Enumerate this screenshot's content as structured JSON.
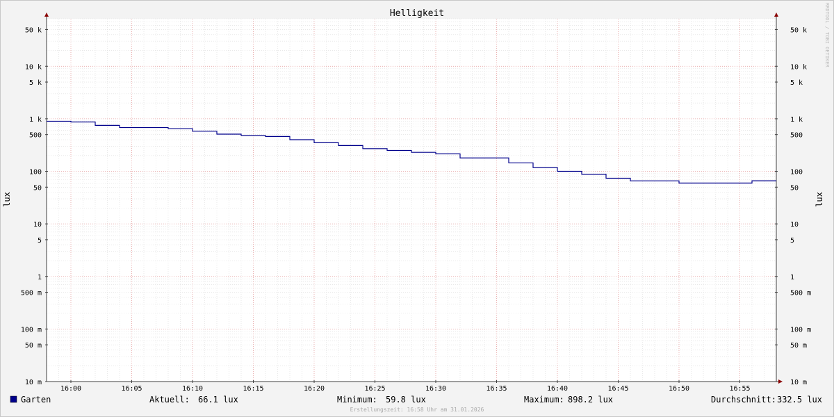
{
  "chart_data": {
    "type": "line",
    "title": "Helligkeit",
    "ylabel": "lux",
    "ylabel_right": "lux",
    "yscale": "log",
    "ylim": [
      0.01,
      80000
    ],
    "xlim": [
      "15:58",
      "16:58"
    ],
    "y_ticks": [
      {
        "value": 50000,
        "label": "50 k"
      },
      {
        "value": 10000,
        "label": "10 k"
      },
      {
        "value": 5000,
        "label": "5 k"
      },
      {
        "value": 1000,
        "label": "1 k"
      },
      {
        "value": 500,
        "label": "500"
      },
      {
        "value": 100,
        "label": "100"
      },
      {
        "value": 50,
        "label": "50"
      },
      {
        "value": 10,
        "label": "10"
      },
      {
        "value": 5,
        "label": "5"
      },
      {
        "value": 1,
        "label": "1"
      },
      {
        "value": 0.5,
        "label": "500 m"
      },
      {
        "value": 0.1,
        "label": "100 m"
      },
      {
        "value": 0.05,
        "label": "50 m"
      },
      {
        "value": 0.01,
        "label": "10 m"
      }
    ],
    "x_ticks": [
      "16:00",
      "16:05",
      "16:10",
      "16:15",
      "16:20",
      "16:25",
      "16:30",
      "16:35",
      "16:40",
      "16:45",
      "16:50",
      "16:55"
    ],
    "grid": true,
    "series": [
      {
        "name": "Garten",
        "color": "#00008b",
        "x": [
          "15:58",
          "16:00",
          "16:02",
          "16:04",
          "16:06",
          "16:08",
          "16:10",
          "16:12",
          "16:14",
          "16:16",
          "16:18",
          "16:20",
          "16:22",
          "16:24",
          "16:26",
          "16:28",
          "16:30",
          "16:32",
          "16:34",
          "16:36",
          "16:38",
          "16:40",
          "16:42",
          "16:44",
          "16:46",
          "16:48",
          "16:50",
          "16:52",
          "16:54",
          "16:56",
          "16:58"
        ],
        "values": [
          898.2,
          870,
          750,
          680,
          680,
          650,
          580,
          510,
          480,
          460,
          400,
          350,
          310,
          270,
          250,
          230,
          215,
          180,
          180,
          145,
          118,
          100,
          88,
          74,
          66,
          66,
          59.8,
          59.8,
          59.8,
          66.1,
          66.1
        ]
      }
    ],
    "stats": {
      "current_label": "Aktuell:",
      "current": "66.1 lux",
      "min_label": "Minimum:",
      "min": "59.8 lux",
      "max_label": "Maximum:",
      "max": "898.2 lux",
      "avg_label": "Durchschnitt:",
      "avg": "332.5 lux"
    },
    "footer": "Erstellungszeit: 16:58 Uhr am 31.01.2026",
    "watermark": "RRDTOOL / TOBI OETIKER"
  }
}
